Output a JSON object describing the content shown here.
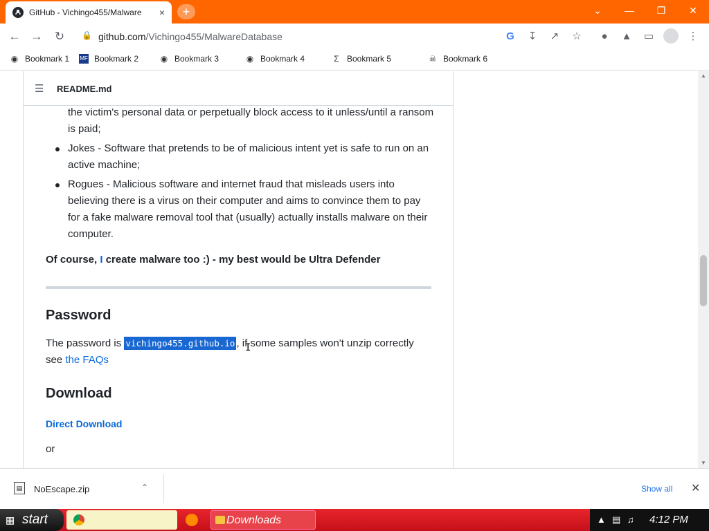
{
  "browser": {
    "tab_title": "GitHub - Vichingo455/Malware",
    "tab_close": "×",
    "new_tab": "+",
    "window_controls": {
      "dropdown": "⌄",
      "minimize": "—",
      "restore": "❐",
      "close": "✕"
    },
    "url_host": "github.com",
    "url_path": "/Vichingo455/MalwareDatabase"
  },
  "bookmarks": [
    {
      "icon": "globe-icon",
      "label": "Bookmark 1"
    },
    {
      "icon": "mediafire-icon",
      "label": "Bookmark 2"
    },
    {
      "icon": "globe-icon",
      "label": "Bookmark 3"
    },
    {
      "icon": "globe-icon",
      "label": "Bookmark 4"
    },
    {
      "icon": "sigma-icon",
      "label": "Bookmark 5"
    },
    {
      "icon": "skull-icon",
      "label": "Bookmark 6"
    }
  ],
  "readme": {
    "file_name": "README.md",
    "list_items": [
      "the victim's personal data or perpetually block access to it unless/until a ransom is paid;",
      "Jokes - Software that pretends to be of malicious intent yet is safe to run on an active machine;",
      "Rogues - Malicious software and internet fraud that misleads users into believing there is a virus on their computer and aims to convince them to pay for a fake malware removal tool that (usually) actually installs malware on their computer."
    ],
    "bold_prefix": "Of course, ",
    "bold_link": "I",
    "bold_suffix": " create malware too :) - my best would be Ultra Defender",
    "password_heading": "Password",
    "password_prefix": "The password is ",
    "password_value": "vichingo455.github.io",
    "password_suffix": ", if some samples won't unzip correctly see ",
    "faq_link": "the FAQs",
    "download_heading": "Download",
    "direct_download": "Direct Download",
    "or_text": "or"
  },
  "download_shelf": {
    "file_name": "NoEscape.zip",
    "show_all": "Show all"
  },
  "taskbar": {
    "start_label": "start",
    "downloads_label": "Downloads",
    "clock": "4:12 PM"
  }
}
